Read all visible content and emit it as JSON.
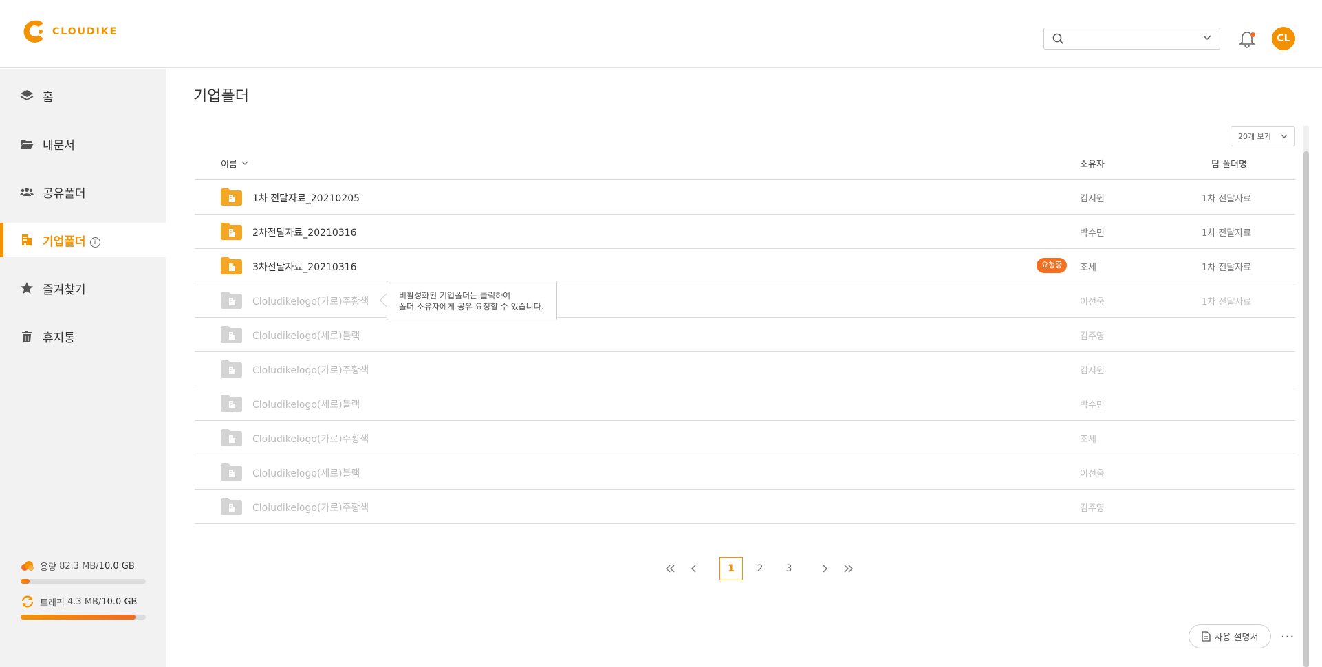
{
  "brand": {
    "name": "CLOUDIKE",
    "color": "#f39200"
  },
  "header": {
    "search_value": "",
    "avatar_initials": "CL",
    "notification_dot_color": "#f37021"
  },
  "sidebar": {
    "items": [
      {
        "label": "홈",
        "icon": "layers-icon",
        "active": false
      },
      {
        "label": "내문서",
        "icon": "folder-open-icon",
        "active": false
      },
      {
        "label": "공유폴더",
        "icon": "users-icon",
        "active": false
      },
      {
        "label": "기업폴더",
        "icon": "building-icon",
        "active": true,
        "info": "i"
      },
      {
        "label": "즐겨찾기",
        "icon": "star-icon",
        "active": false
      },
      {
        "label": "휴지통",
        "icon": "trash-icon",
        "active": false
      }
    ],
    "storage": {
      "label": "용량",
      "used": "82.3 MB",
      "sep": " / ",
      "total": "10.0 GB",
      "fraction": 0.07
    },
    "traffic": {
      "label": "트래픽",
      "used": "4.3 MB",
      "sep": " / ",
      "total": "10.0 GB",
      "fraction": 0.92
    }
  },
  "main": {
    "title": "기업폴더",
    "page_size_label": "20개 보기",
    "columns": {
      "name": "이름",
      "owner": "소유자",
      "team": "팀 폴더명"
    },
    "rows": [
      {
        "name": "1차 전달자료_20210205",
        "owner": "김지원",
        "team": "1차 전달자료",
        "enabled": true,
        "badge": ""
      },
      {
        "name": "2차전달자료_20210316",
        "owner": "박수민",
        "team": "1차 전달자료",
        "enabled": true,
        "badge": ""
      },
      {
        "name": "3차전달자료_20210316",
        "owner": "조세",
        "team": "1차 전달자료",
        "enabled": true,
        "badge": "요청중"
      },
      {
        "name": "Cloludikelogo(가로)주황색",
        "owner": "이선웅",
        "team": "1차 전달자료",
        "enabled": false,
        "badge": ""
      },
      {
        "name": "Cloludikelogo(세로)블랙",
        "owner": "김주영",
        "team": "",
        "enabled": false,
        "badge": ""
      },
      {
        "name": "Cloludikelogo(가로)주황색",
        "owner": "김지원",
        "team": "",
        "enabled": false,
        "badge": ""
      },
      {
        "name": "Cloludikelogo(세로)블랙",
        "owner": "박수민",
        "team": "",
        "enabled": false,
        "badge": ""
      },
      {
        "name": "Cloludikelogo(가로)주황색",
        "owner": "조세",
        "team": "",
        "enabled": false,
        "badge": ""
      },
      {
        "name": "Cloludikelogo(세로)블랙",
        "owner": "이선웅",
        "team": "",
        "enabled": false,
        "badge": ""
      },
      {
        "name": "Cloludikelogo(가로)주황색",
        "owner": "김주영",
        "team": "",
        "enabled": false,
        "badge": ""
      }
    ],
    "tooltip": {
      "line1": "비활성화된 기업폴더는 클릭하여",
      "line2": "폴더 소유자에게 공유 요청할 수 있습니다."
    },
    "pagination": {
      "pages": [
        "1",
        "2",
        "3"
      ],
      "current": "1"
    },
    "manual_button": "사용 설명서",
    "more_label": "···"
  },
  "colors": {
    "accent": "#f39200",
    "badge": "#f37021",
    "folder_active": "#f5a623",
    "folder_disabled": "#d4d4d4"
  }
}
